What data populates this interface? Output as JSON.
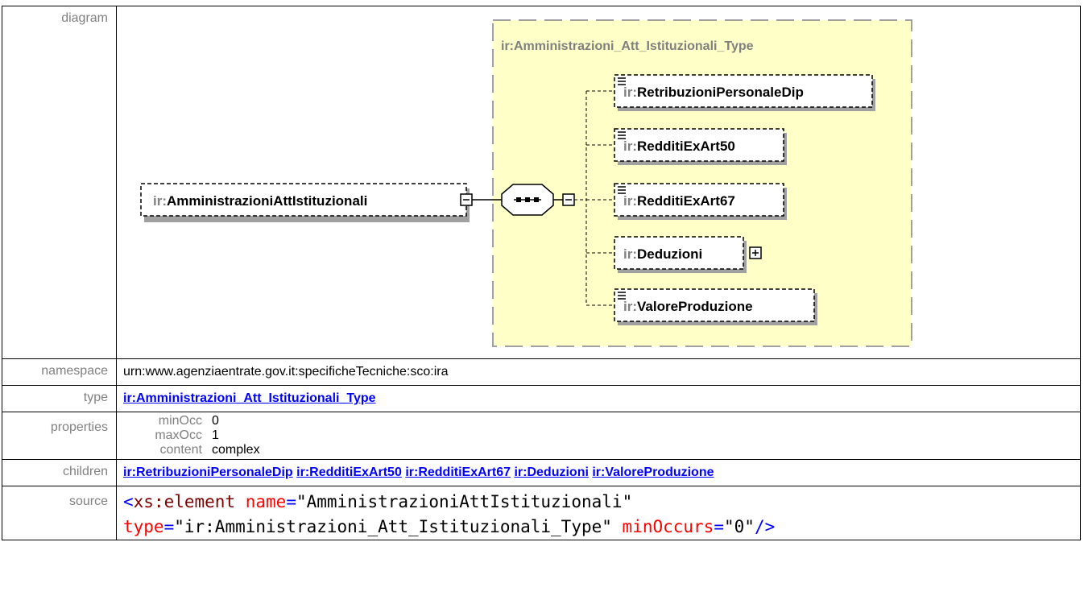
{
  "rows": {
    "diagram_label": "diagram",
    "namespace_label": "namespace",
    "namespace_value": "urn:www.agenziaentrate.gov.it:specificheTecniche:sco:ira",
    "type_label": "type",
    "type_value": "ir:Amministrazioni_Att_Istituzionali_Type",
    "properties_label": "properties",
    "properties": [
      {
        "key": "minOcc",
        "value": "0"
      },
      {
        "key": "maxOcc",
        "value": "1"
      },
      {
        "key": "content",
        "value": "complex"
      }
    ],
    "children_label": "children",
    "children": [
      "ir:RetribuzioniPersonaleDip",
      "ir:RedditiExArt50",
      "ir:RedditiExArt67",
      "ir:Deduzioni",
      "ir:ValoreProduzione"
    ],
    "source_label": "source"
  },
  "source": {
    "open": "<",
    "element": "xs:element",
    "attr_name": "name",
    "eq": "=",
    "val_name": "\"AmministrazioniAttIstituzionali\"",
    "attr_type": "type",
    "val_type": "\"ir:Amministrazioni_Att_Istituzionali_Type\"",
    "attr_min": "minOccurs",
    "val_min": "\"0\"",
    "close": "/>"
  },
  "diagram": {
    "root_prefix": "ir:",
    "root_name": "AmministrazioniAttIstituzionali",
    "type_box_title": "ir:Amministrazioni_Att_Istituzionali_Type",
    "children": [
      {
        "prefix": "ir:",
        "name": "RetribuzioniPersonaleDip"
      },
      {
        "prefix": "ir:",
        "name": "RedditiExArt50"
      },
      {
        "prefix": "ir:",
        "name": "RedditiExArt67"
      },
      {
        "prefix": "ir:",
        "name": "Deduzioni"
      },
      {
        "prefix": "ir:",
        "name": "ValoreProduzione"
      }
    ],
    "colors": {
      "type_box_fill": "#ffffc8",
      "type_box_border": "#a0a0a0",
      "prefix": "#808080",
      "shadow": "#a0a0a0"
    }
  }
}
